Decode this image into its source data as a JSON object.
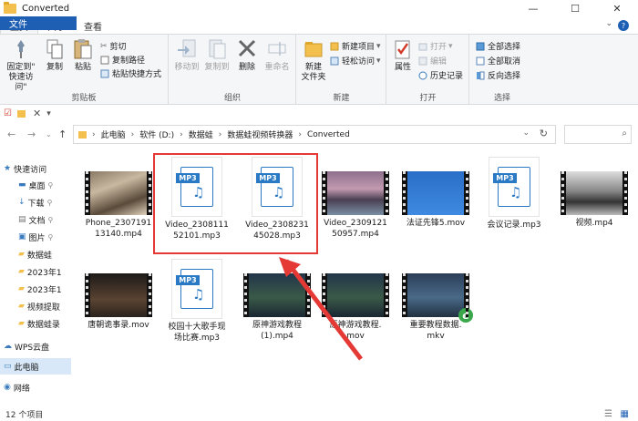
{
  "window": {
    "title": "Converted",
    "minimize": "—",
    "maximize": "☐",
    "close": "✕"
  },
  "tabs": [
    "文件",
    "主页",
    "共享",
    "查看"
  ],
  "ribbon": {
    "clipboard": {
      "label": "剪贴板",
      "pin": "固定到\"\n快速访问\"",
      "copy": "复制",
      "paste": "粘贴",
      "cut": "剪切",
      "copy_path": "复制路径",
      "paste_shortcut": "粘贴快捷方式"
    },
    "organize": {
      "label": "组织",
      "move_to": "移动到",
      "copy_to": "复制到",
      "delete": "删除",
      "rename": "重命名"
    },
    "new": {
      "label": "新建",
      "new_folder": "新建\n文件夹",
      "new_item": "新建项目",
      "easy_access": "轻松访问"
    },
    "open": {
      "label": "打开",
      "properties": "属性",
      "open": "打开",
      "edit": "编辑",
      "history": "历史记录"
    },
    "select": {
      "label": "选择",
      "select_all": "全部选择",
      "select_none": "全部取消",
      "invert": "反向选择"
    }
  },
  "address": {
    "crumbs": [
      "此电脑",
      "软件 (D:)",
      "数据蛙",
      "数据蛙视频转换器",
      "Converted"
    ]
  },
  "navpane": [
    {
      "label": "快速访问",
      "type": "star"
    },
    {
      "label": "桌面",
      "type": "desktop"
    },
    {
      "label": "下载",
      "type": "download"
    },
    {
      "label": "文档",
      "type": "doc"
    },
    {
      "label": "图片",
      "type": "pic"
    },
    {
      "label": "数据蛙",
      "type": "folder"
    },
    {
      "label": "2023年1",
      "type": "folder"
    },
    {
      "label": "2023年1",
      "type": "folder"
    },
    {
      "label": "视频提取",
      "type": "folder"
    },
    {
      "label": "数据蛙录",
      "type": "folder"
    },
    {
      "label": "WPS云盘",
      "type": "cloud"
    },
    {
      "label": "此电脑",
      "type": "pc"
    },
    {
      "label": "网络",
      "type": "net"
    }
  ],
  "files": [
    {
      "name": "Phone_2307191\n13140.mp4",
      "kind": "video",
      "theme": "cat"
    },
    {
      "name": "Video_2308111\n52101.mp3",
      "kind": "mp3"
    },
    {
      "name": "Video_2308231\n45028.mp3",
      "kind": "mp3"
    },
    {
      "name": "Video_2309121\n50957.mp4",
      "kind": "video",
      "theme": "mountain"
    },
    {
      "name": "法证先锋5.mov",
      "kind": "video",
      "theme": "desktop"
    },
    {
      "name": "会议记录.mp3",
      "kind": "mp3"
    },
    {
      "name": "视频.mp4",
      "kind": "video",
      "theme": "ink"
    },
    {
      "name": "唐朝诡事录.mov",
      "kind": "video",
      "theme": "night"
    },
    {
      "name": "校园十大歌手现\n场比赛.mp3",
      "kind": "mp3"
    },
    {
      "name": "原神游戏教程\n(1).mp4",
      "kind": "video",
      "theme": "game"
    },
    {
      "name": "原神游戏教程.\nmov",
      "kind": "video",
      "theme": "game"
    },
    {
      "name": "重要教程数据.\nmkv",
      "kind": "video",
      "theme": "game2"
    }
  ],
  "mp3_tag": "MP3",
  "status": {
    "count": "12 个项目"
  },
  "colors": {
    "accent": "#1e5fb4",
    "annotation": "#e53935",
    "mp3": "#2a79c4"
  }
}
